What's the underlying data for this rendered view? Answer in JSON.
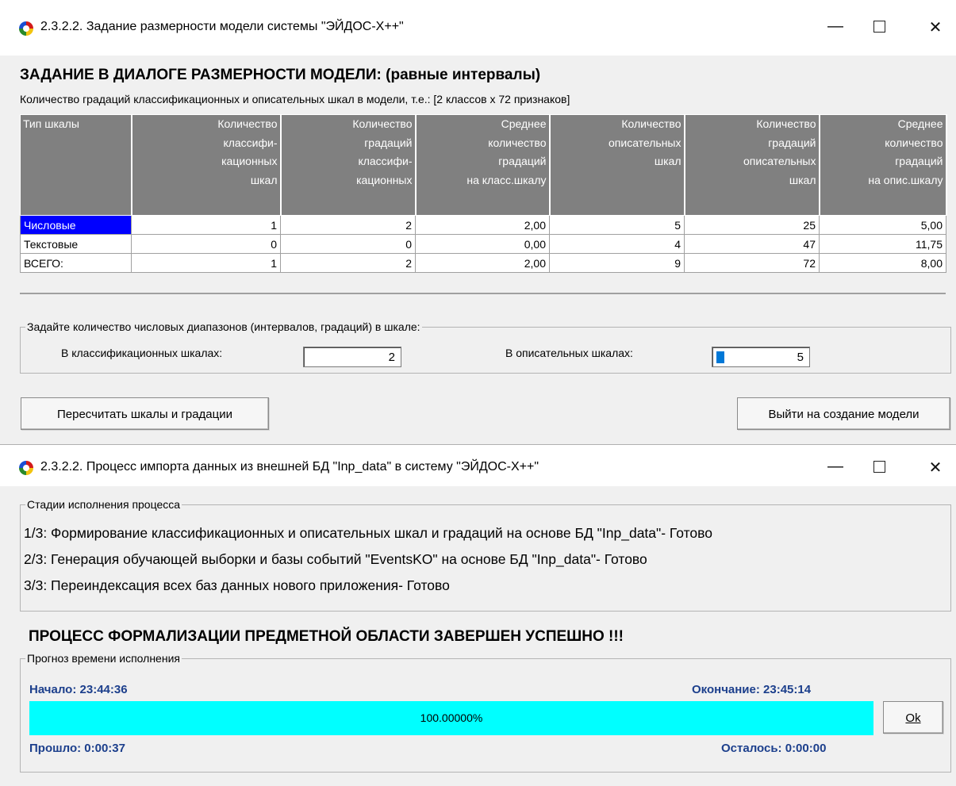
{
  "window1": {
    "title": "2.3.2.2. Задание размерности модели системы \"ЭЙДОС-X++\"",
    "heading": "ЗАДАНИЕ В ДИАЛОГЕ РАЗМЕРНОСТИ МОДЕЛИ: (равные интервалы)",
    "subtitle": "Количество градаций классификационных и описательных шкал в модели, т.е.: [2 классов х 72 признаков]",
    "table": {
      "headers": [
        [
          "Тип шкалы"
        ],
        [
          "Количество",
          "классифи-",
          "кационных",
          "шкал"
        ],
        [
          "Количество",
          "градаций",
          "классифи-",
          "кационных"
        ],
        [
          "Среднее",
          "количество",
          "градаций",
          "на класс.шкалу"
        ],
        [
          "Количество",
          "описательных",
          "шкал"
        ],
        [
          "Количество",
          "градаций",
          "описательных",
          "шкал"
        ],
        [
          "Среднее",
          "количество",
          "градаций",
          "на опис.шкалу"
        ]
      ],
      "rows": [
        [
          "Числовые",
          "1",
          "2",
          "2,00",
          "5",
          "25",
          "5,00"
        ],
        [
          "Текстовые",
          "0",
          "0",
          "0,00",
          "4",
          "47",
          "11,75"
        ],
        [
          "ВСЕГО:",
          "1",
          "2",
          "2,00",
          "9",
          "72",
          "8,00"
        ]
      ]
    },
    "ranges_group": {
      "legend": "Задайте количество числовых диапазонов (интервалов, градаций) в шкале:",
      "class_label": "В классификационных шкалах:",
      "class_value": "2",
      "desc_label": "В описательных шкалах:",
      "desc_value": "5"
    },
    "recalc_button": "Пересчитать шкалы и градации",
    "exit_button": "Выйти на создание модели"
  },
  "window2": {
    "title": "2.3.2.2. Процесс импорта данных из внешней БД \"Inp_data\" в систему \"ЭЙДОС-X++\"",
    "stages_legend": "Стадии исполнения процесса",
    "stages": [
      "1/3: Формирование классификационных и описательных шкал и градаций на основе БД \"Inp_data\"- Готово",
      "2/3: Генерация обучающей выборки и базы событий \"EventsKO\" на основе БД \"Inp_data\"- Готово",
      "3/3: Переиндексация всех баз данных нового приложения- Готово"
    ],
    "status": "ПРОЦЕСС ФОРМАЛИЗАЦИИ ПРЕДМЕТНОЙ ОБЛАСТИ ЗАВЕРШЕН УСПЕШНО !!!",
    "forecast_legend": "Прогноз времени исполнения",
    "start": "Начало: 23:44:36",
    "end": "Окончание: 23:45:14",
    "elapsed": "Прошло: 0:00:37",
    "remaining": "Осталось: 0:00:00",
    "progress_text": "100.00000%",
    "progress_fraction": 1.0,
    "ok_button": "Ok"
  },
  "window_controls": {
    "minimize": "—",
    "close": "✕"
  },
  "colors": {
    "progress": "#00ffff",
    "selection": "#0000ff",
    "header_bg": "#808080",
    "time_text": "#1c3f8c"
  }
}
